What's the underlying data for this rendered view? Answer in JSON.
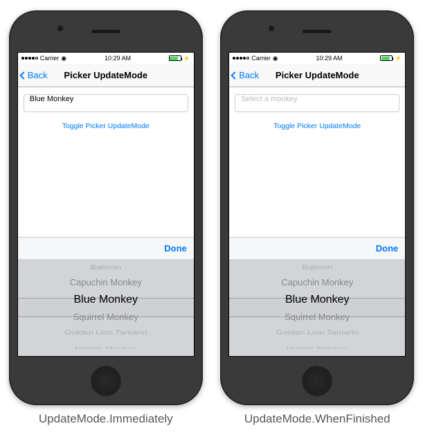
{
  "status": {
    "carrier": "Carrier",
    "time": "10:29 AM"
  },
  "nav": {
    "back": "Back",
    "title": "Picker UpdateMode"
  },
  "screens": [
    {
      "input_value": "Blue Monkey",
      "input_is_placeholder": false
    },
    {
      "input_value": "Select a monkey",
      "input_is_placeholder": true
    }
  ],
  "toggle_label": "Toggle Picker UpdateMode",
  "toolbar": {
    "done": "Done"
  },
  "picker": {
    "items": [
      "Baboon",
      "Capuchin Monkey",
      "Blue Monkey",
      "Squirrel Monkey",
      "Golden Lion Tamarin",
      "Howler Monkey"
    ],
    "selected_index": 2
  },
  "captions": [
    "UpdateMode.Immediately",
    "UpdateMode.WhenFinished"
  ]
}
